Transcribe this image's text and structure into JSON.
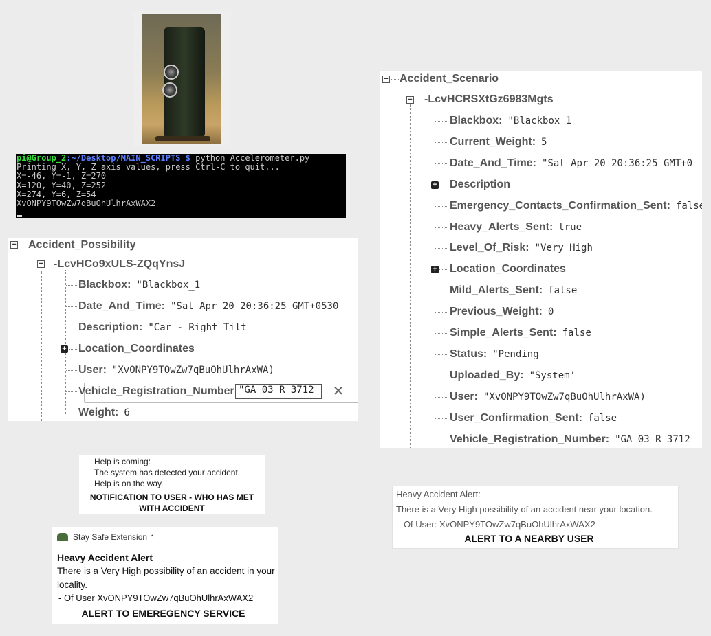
{
  "terminal": {
    "user_host": "pi@Group_2",
    "path": ":~/Desktop/MAIN_SCRIPTS $",
    "command": " python Accelerometer.py",
    "lines": [
      "Printing X, Y, Z axis values, press Ctrl-C to quit...",
      "X=-46, Y=-1, Z=270",
      "X=120, Y=40, Z=252",
      "X=274, Y=6, Z=54",
      "XvONPY9TOwZw7qBuOhUlhrAxWAX2"
    ]
  },
  "possibility_tree": {
    "root": "Accident_Possibility",
    "child": "-LcvHCo9xULS-ZQqYnsJ",
    "fields": [
      {
        "key": "Blackbox:",
        "value": "\"Blackbox_1"
      },
      {
        "key": "Date_And_Time:",
        "value": "\"Sat Apr 20 20:36:25 GMT+0530"
      },
      {
        "key": "Description:",
        "value": "\"Car - Right Tilt"
      },
      {
        "key": "Location_Coordinates",
        "value": ""
      },
      {
        "key": "User:",
        "value": "\"XvONPY9TOwZw7qBuOhUlhrAxWA)"
      },
      {
        "key": "Vehicle_Registration_Number:",
        "value": "\"GA 03 R 3712"
      },
      {
        "key": "Weight:",
        "value": "6"
      }
    ],
    "close_glyph": "✕"
  },
  "scenario_tree": {
    "root": "Accident_Scenario",
    "child": "-LcvHCRSXtGz6983Mgts",
    "fields": [
      {
        "key": "Blackbox:",
        "value": "\"Blackbox_1"
      },
      {
        "key": "Current_Weight:",
        "value": "5"
      },
      {
        "key": "Date_And_Time:",
        "value": "\"Sat Apr 20 20:36:25 GMT+0"
      },
      {
        "key": "Description",
        "value": ""
      },
      {
        "key": "Emergency_Contacts_Confirmation_Sent:",
        "value": "false"
      },
      {
        "key": "Heavy_Alerts_Sent:",
        "value": "true"
      },
      {
        "key": "Level_Of_Risk:",
        "value": "\"Very High"
      },
      {
        "key": "Location_Coordinates",
        "value": ""
      },
      {
        "key": "Mild_Alerts_Sent:",
        "value": "false"
      },
      {
        "key": "Previous_Weight:",
        "value": "0"
      },
      {
        "key": "Simple_Alerts_Sent:",
        "value": "false"
      },
      {
        "key": "Status:",
        "value": "\"Pending"
      },
      {
        "key": "Uploaded_By:",
        "value": "\"System'"
      },
      {
        "key": "User:",
        "value": "\"XvONPY9TOwZw7qBuOhUlhrAxWA)"
      },
      {
        "key": "User_Confirmation_Sent:",
        "value": "false"
      },
      {
        "key": "Vehicle_Registration_Number:",
        "value": "\"GA 03 R 3712"
      }
    ]
  },
  "user_notification": {
    "line1": "Help is coming:",
    "line2": "The system has detected your accident.",
    "line3": "Help is on the way.",
    "caption1": "NOTIFICATION TO USER - WHO HAS MET",
    "caption2": "WITH ACCIDENT"
  },
  "nearby_alert": {
    "title": "Heavy Accident Alert:",
    "body": "There is a Very High possibility of an accident near your location.",
    "from": "- Of User: XvONPY9TOwZw7qBuOhUlhrAxWAX2",
    "caption": "ALERT TO A NEARBY USER"
  },
  "emergency_alert": {
    "app_name": "Stay Safe Extension",
    "title": "Heavy Accident Alert",
    "body1": "There is a Very High possibility of an accident in your",
    "body2": "locality.",
    "from": "- Of User XvONPY9TOwZw7qBuOhUlhrAxWAX2",
    "caption": "ALERT TO EMEREGENCY SERVICE"
  }
}
